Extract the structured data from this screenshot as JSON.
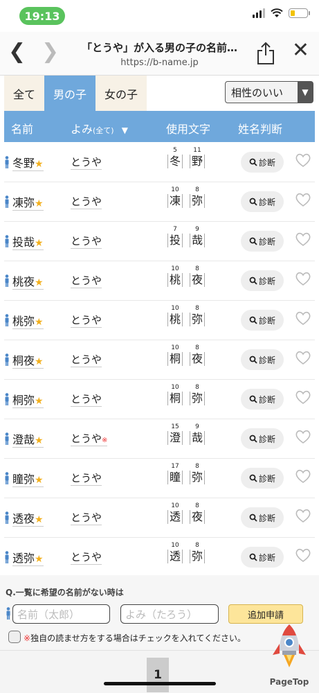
{
  "status": {
    "time": "19:13"
  },
  "browser": {
    "title": "「とうや」が入る男の子の名前…",
    "url": "https://b-name.jp"
  },
  "tabs": [
    "全て",
    "男の子",
    "女の子"
  ],
  "sort_select": "相性のいい",
  "table_header": {
    "name": "名前",
    "yomi": "よみ",
    "yomi_sub": "(全て)",
    "yomi_arrow": "▼",
    "chars": "使用文字",
    "judge": "姓名判断"
  },
  "rows": [
    {
      "name": "冬野",
      "yomi": "とうや",
      "mark": "",
      "k1": "冬",
      "n1": "5",
      "k2": "野",
      "n2": "11"
    },
    {
      "name": "凍弥",
      "yomi": "とうや",
      "mark": "",
      "k1": "凍",
      "n1": "10",
      "k2": "弥",
      "n2": "8"
    },
    {
      "name": "投哉",
      "yomi": "とうや",
      "mark": "",
      "k1": "投",
      "n1": "7",
      "k2": "哉",
      "n2": "9"
    },
    {
      "name": "桃夜",
      "yomi": "とうや",
      "mark": "",
      "k1": "桃",
      "n1": "10",
      "k2": "夜",
      "n2": "8"
    },
    {
      "name": "桃弥",
      "yomi": "とうや",
      "mark": "",
      "k1": "桃",
      "n1": "10",
      "k2": "弥",
      "n2": "8"
    },
    {
      "name": "桐夜",
      "yomi": "とうや",
      "mark": "",
      "k1": "桐",
      "n1": "10",
      "k2": "夜",
      "n2": "8"
    },
    {
      "name": "桐弥",
      "yomi": "とうや",
      "mark": "",
      "k1": "桐",
      "n1": "10",
      "k2": "弥",
      "n2": "8"
    },
    {
      "name": "澄哉",
      "yomi": "とうや",
      "mark": "※",
      "k1": "澄",
      "n1": "15",
      "k2": "哉",
      "n2": "9"
    },
    {
      "name": "瞳弥",
      "yomi": "とうや",
      "mark": "",
      "k1": "瞳",
      "n1": "17",
      "k2": "弥",
      "n2": "8"
    },
    {
      "name": "透夜",
      "yomi": "とうや",
      "mark": "",
      "k1": "透",
      "n1": "10",
      "k2": "夜",
      "n2": "8"
    },
    {
      "name": "透弥",
      "yomi": "とうや",
      "mark": "",
      "k1": "透",
      "n1": "10",
      "k2": "弥",
      "n2": "8"
    }
  ],
  "star": "★",
  "diagnose_label": "診断",
  "question": {
    "title": "Q.一覧に希望の名前がない時は",
    "name_placeholder": "名前（太郎）",
    "yomi_placeholder": "よみ（たろう）",
    "add_button": "追加申請",
    "check_mark": "※",
    "check_label": "独自の読ませ方をする場合はチェックを入れてください。"
  },
  "pager": {
    "current": "1",
    "pagetop_label": "PageTop"
  },
  "colors": {
    "accent": "#6fa8dc",
    "star": "#f2b01e",
    "status_pill": "#5ac35d"
  }
}
